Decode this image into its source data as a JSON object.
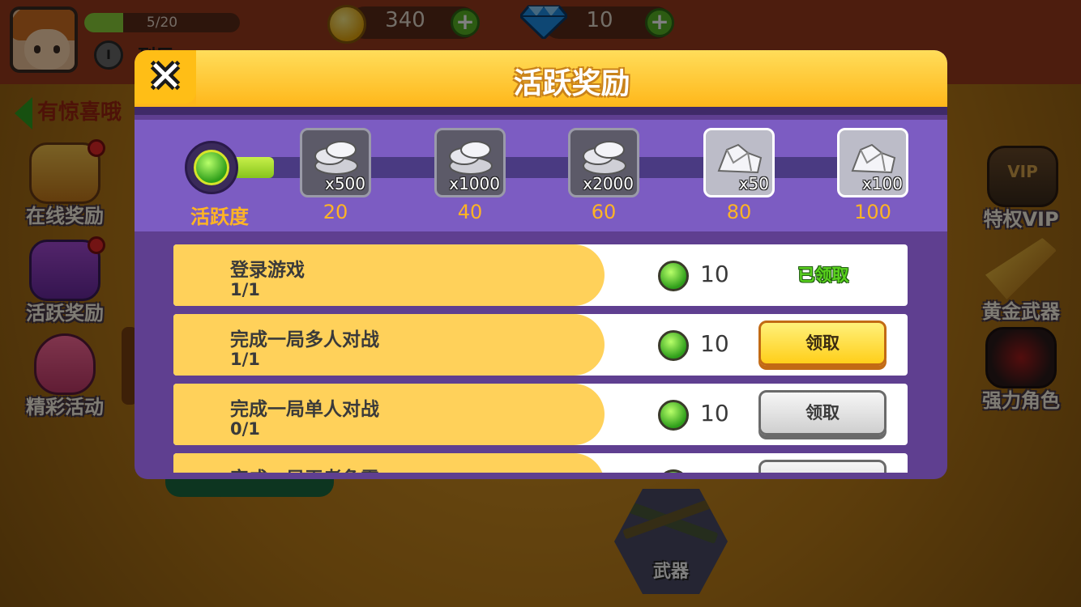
{
  "hud": {
    "xp_text": "5/20",
    "xp_fraction": 0.25,
    "rank_label": "I",
    "player_name": "列巨",
    "coins": "340",
    "gems": "10"
  },
  "left_link": "有惊喜哦",
  "side_left": [
    {
      "label": "在线奖励",
      "icon": "chest-icon",
      "badge": true
    },
    {
      "label": "活跃奖励",
      "icon": "star-box-icon",
      "badge": true
    },
    {
      "label": "精彩活动",
      "icon": "egg-icon",
      "badge": false
    }
  ],
  "side_right": [
    {
      "label": "特权VIP",
      "icon": "vip-diamond-icon",
      "art_text": "VIP"
    },
    {
      "label": "黄金武器",
      "icon": "golden-gun-icon"
    },
    {
      "label": "强力角色",
      "icon": "demon-character-icon"
    }
  ],
  "weapon_tab": {
    "label": "武器"
  },
  "modal": {
    "title": "活跃奖励",
    "close_glyph": "✕",
    "activity_label": "活跃度",
    "progress_fraction": 0.1,
    "rewards": [
      {
        "qty": "x500",
        "threshold": "20",
        "kind": "silver-coins"
      },
      {
        "qty": "x1000",
        "threshold": "40",
        "kind": "silver-coins"
      },
      {
        "qty": "x2000",
        "threshold": "60",
        "kind": "silver-coins"
      },
      {
        "qty": "x50",
        "threshold": "80",
        "kind": "diamonds"
      },
      {
        "qty": "x100",
        "threshold": "100",
        "kind": "diamonds"
      }
    ],
    "tasks": [
      {
        "name": "登录游戏",
        "progress": "1/1",
        "points": "10",
        "status": "claimed",
        "status_label": "已领取"
      },
      {
        "name": "完成一局多人对战",
        "progress": "1/1",
        "points": "10",
        "status": "claimable",
        "status_label": "领取"
      },
      {
        "name": "完成一局单人对战",
        "progress": "0/1",
        "points": "10",
        "status": "locked",
        "status_label": "领取"
      },
      {
        "name": "完成一局王者争霸",
        "progress": "",
        "points": "",
        "status": "locked",
        "status_label": ""
      }
    ]
  },
  "colors": {
    "modal_bg": "#5f3f90",
    "header_gold": "#ffb71a",
    "activity_orange": "#ffb424",
    "claimed_green": "#5ad21e"
  }
}
